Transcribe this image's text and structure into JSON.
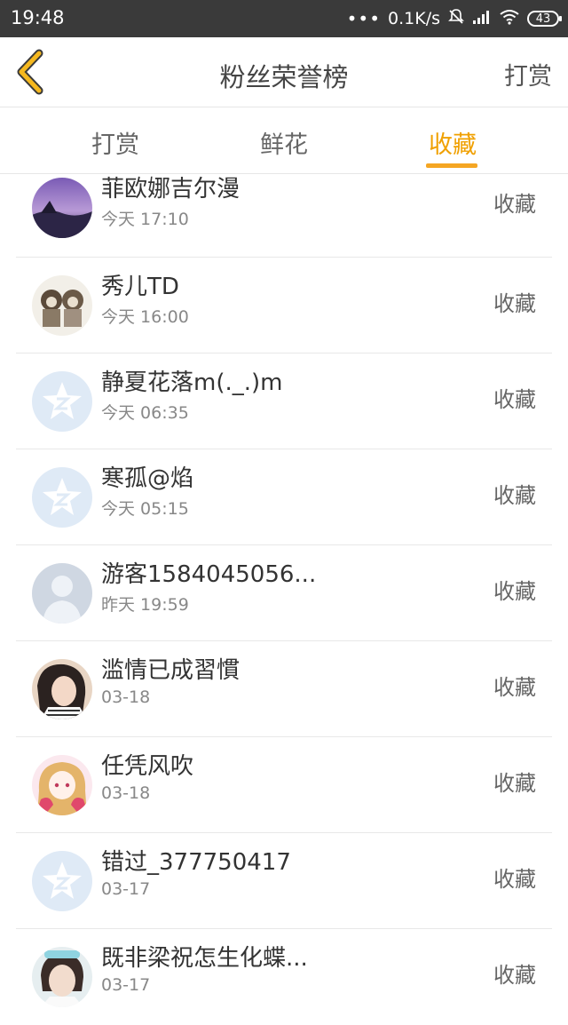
{
  "status_bar": {
    "time": "19:48",
    "dots": "•••",
    "speed": "0.1K/s",
    "battery": "43",
    "icons": [
      "mute-icon",
      "signal-icon",
      "wifi-icon",
      "battery-icon"
    ]
  },
  "header": {
    "title": "粉丝荣誉榜",
    "action": "打赏",
    "back_icon": "chevron-left-icon",
    "accent_color": "#f5a623"
  },
  "tabs": [
    {
      "label": "打赏",
      "active": false
    },
    {
      "label": "鲜花",
      "active": false
    },
    {
      "label": "收藏",
      "active": true
    }
  ],
  "list": [
    {
      "name": "菲欧娜吉尔漫",
      "time": "今天 17:10",
      "type": "收藏",
      "avatar": "landscape-avatar"
    },
    {
      "name": "秀儿TD",
      "time": "今天 16:00",
      "type": "收藏",
      "avatar": "sketch-avatar"
    },
    {
      "name": "静夏花落m(._.)m",
      "time": "今天 06:35",
      "type": "收藏",
      "avatar": "default-qzone-avatar"
    },
    {
      "name": "寒孤@焰",
      "time": "今天 05:15",
      "type": "收藏",
      "avatar": "default-qzone-avatar"
    },
    {
      "name": "游客1584045056...",
      "time": "昨天 19:59",
      "type": "收藏",
      "avatar": "default-person-avatar"
    },
    {
      "name": "滥情已成習慣",
      "time": "03-18",
      "type": "收藏",
      "avatar": "photo-avatar"
    },
    {
      "name": "任凭风吹",
      "time": "03-18",
      "type": "收藏",
      "avatar": "anime-avatar"
    },
    {
      "name": "错过_377750417",
      "time": "03-17",
      "type": "收藏",
      "avatar": "default-qzone-avatar"
    },
    {
      "name": "既非梁祝怎生化蝶...",
      "time": "03-17",
      "type": "收藏",
      "avatar": "photo-avatar"
    }
  ]
}
